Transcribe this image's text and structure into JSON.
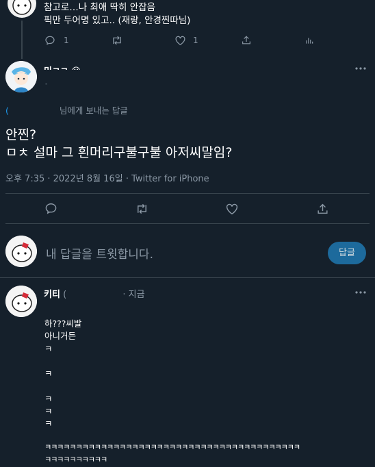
{
  "top_tweet": {
    "lines": [
      "참고로…나 최애 딱히 안잡음",
      "픽만 두어명 있고.. (재랑, 안경찐따님)"
    ],
    "reply_count": "1",
    "like_count": "1"
  },
  "main_tweet": {
    "display_name": "미ㅋㄹ ☺",
    "handle": "-",
    "replying_to_suffix": "님에게 보내는 답글",
    "text_line1": "안찐?",
    "text_line2": "ㅁㅊ 설마 그 흰머리구불구불 아저씨말임?",
    "meta": "오후 7:35 · 2022년 8월 16일 · Twitter for iPhone"
  },
  "compose": {
    "placeholder": "내 답글을 트윗합니다.",
    "button_label": "답글"
  },
  "reply": {
    "display_name": "키티",
    "handle_open": "(",
    "time": "· 지금",
    "lines": [
      "하???씨발",
      "아니거든",
      "ㅋ",
      "",
      "ㅋ",
      "",
      "ㅋ",
      "ㅋ",
      "ㅋ",
      "",
      "ㅋㅋㅋㅋㅋㅋㅋㅋㅋㅋㅋㅋㅋㅋㅋㅋㅋㅋㅋㅋㅋㅋㅋㅋㅋㅋㅋㅋㅋㅋㅋㅋㅋㅋㅋㅋㅋㅋㅋㅋㅋ",
      "ㅋㅋㅋㅋㅋㅋㅋㅋㅋㅋ"
    ]
  },
  "colors": {
    "background": "#15202b",
    "muted_text": "#8b98a5",
    "divider": "#38444d",
    "accent": "#1d9bf0"
  },
  "icons": [
    "reply-icon",
    "retweet-icon",
    "like-icon",
    "share-icon",
    "analytics-icon",
    "more-icon"
  ]
}
